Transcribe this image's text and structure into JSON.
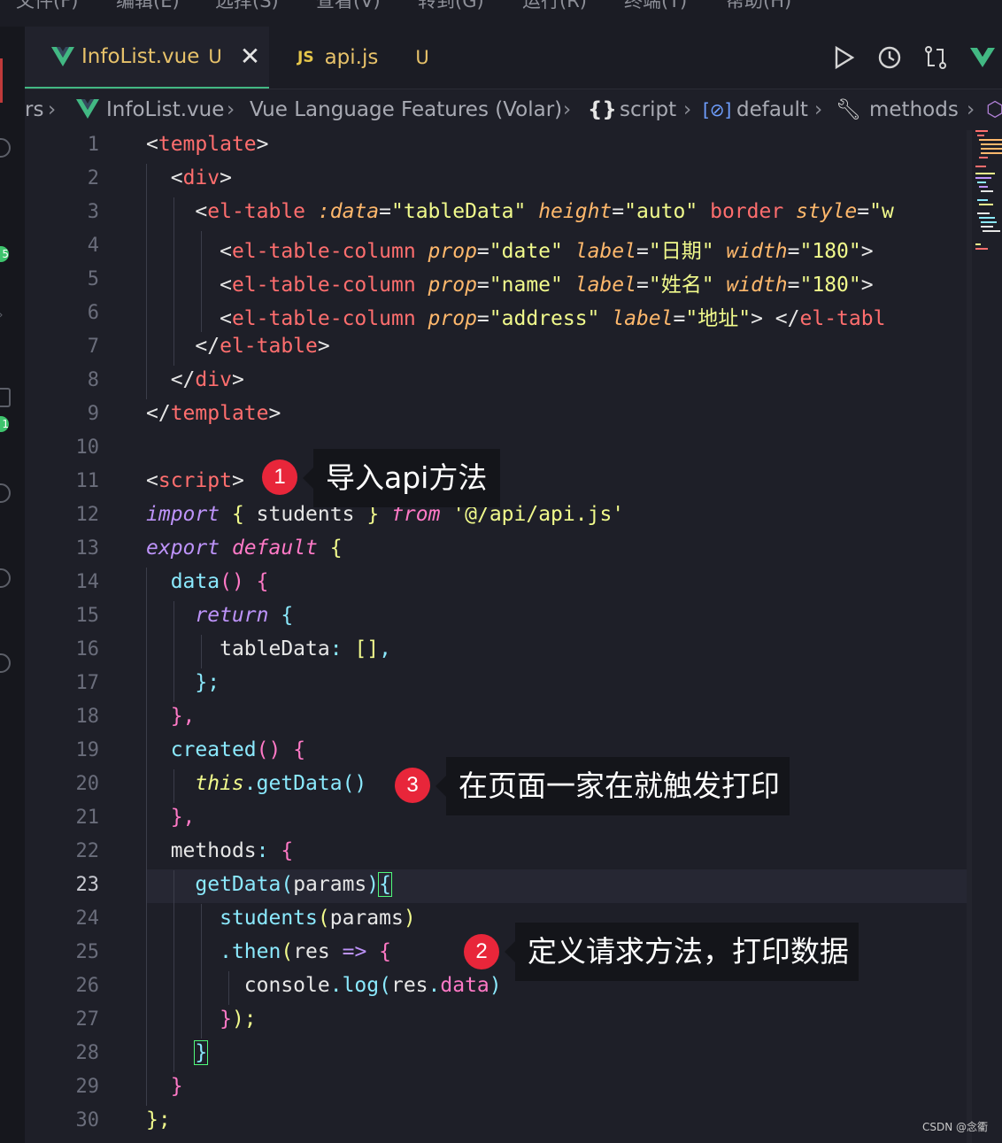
{
  "menubar": {
    "items": [
      "文件(F)",
      "编辑(E)",
      "选择(S)",
      "查看(V)",
      "转到(G)",
      "运行(R)",
      "终端(T)",
      "帮助(H)"
    ]
  },
  "tabs": [
    {
      "name": "InfoList.vue",
      "status": "U",
      "icon": "vue-icon",
      "active": true
    },
    {
      "name": "api.js",
      "status": "U",
      "icon": "js-icon",
      "badge": "JS",
      "active": false
    }
  ],
  "toolbar_icons": [
    "run-icon",
    "timeline-icon",
    "compare-changes-icon",
    "vue-devtools-icon"
  ],
  "breadcrumb": {
    "prefix": "rs",
    "file": "InfoList.vue",
    "feature": "Vue Language Features (Volar)",
    "script": "script",
    "default": "default",
    "methods": "methods"
  },
  "editor": {
    "current_line": 23,
    "line_numbers": [
      "1",
      "2",
      "3",
      "4",
      "5",
      "6",
      "7",
      "8",
      "9",
      "10",
      "11",
      "12",
      "13",
      "14",
      "15",
      "16",
      "17",
      "18",
      "19",
      "20",
      "21",
      "22",
      "23",
      "24",
      "25",
      "26",
      "27",
      "28",
      "29",
      "30"
    ]
  },
  "annotations": [
    {
      "number": "1",
      "text": "导入api方法"
    },
    {
      "number": "2",
      "text": "定义请求方法，打印数据"
    },
    {
      "number": "3",
      "text": "在页面一家在就触发打印"
    }
  ],
  "watermark": "CSDN @念衢",
  "colors": {
    "accent": "#42b883",
    "badge": "#e8263a",
    "background": "#1e1f28"
  }
}
